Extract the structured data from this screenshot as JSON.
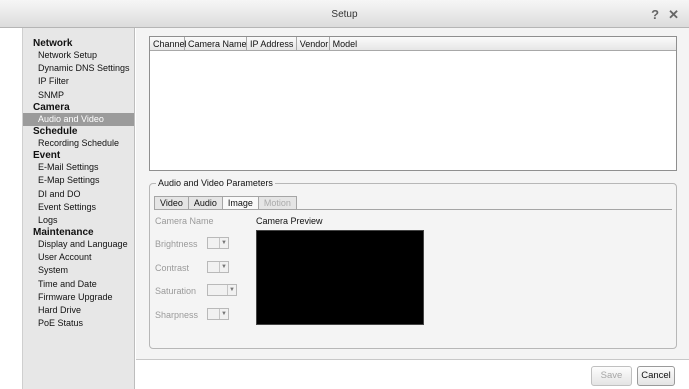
{
  "window": {
    "title": "Setup",
    "help_icon": "?",
    "close_icon": "✕"
  },
  "sidebar": {
    "groups": [
      {
        "label": "Network",
        "items": [
          "Network Setup",
          "Dynamic DNS Settings",
          "IP Filter",
          "SNMP"
        ]
      },
      {
        "label": "Camera",
        "items": [
          "Audio and Video"
        ]
      },
      {
        "label": "Schedule",
        "items": [
          "Recording Schedule"
        ]
      },
      {
        "label": "Event",
        "items": [
          "E-Mail Settings",
          "E-Map Settings",
          "DI and DO",
          "Event Settings",
          "Logs"
        ]
      },
      {
        "label": "Maintenance",
        "items": [
          "Display and Language",
          "User Account",
          "System",
          "Time and Date",
          "Firmware Upgrade",
          "Hard Drive",
          "PoE Status"
        ]
      }
    ],
    "selected_item": "Audio and Video"
  },
  "camera_table": {
    "columns": [
      "Channel",
      "Camera Name",
      "IP Address",
      "Vendor",
      "Model"
    ],
    "rows": []
  },
  "av_params": {
    "legend": "Audio and Video Parameters",
    "tabs": [
      {
        "label": "Video",
        "state": "normal"
      },
      {
        "label": "Audio",
        "state": "normal"
      },
      {
        "label": "Image",
        "state": "active"
      },
      {
        "label": "Motion",
        "state": "disabled"
      }
    ],
    "camera_name_label": "Camera Name",
    "camera_preview_label": "Camera Preview",
    "brightness_label": "Brightness",
    "contrast_label": "Contrast",
    "saturation_label": "Saturation",
    "sharpness_label": "Sharpness",
    "brightness_value": "",
    "contrast_value": "",
    "saturation_value": "",
    "sharpness_value": "",
    "spinner_arrow": "▼"
  },
  "footer": {
    "save_label": "Save",
    "cancel_label": "Cancel"
  },
  "colors": {
    "selected_bg": "#9b9b9b",
    "preview_bg": "#000000"
  }
}
